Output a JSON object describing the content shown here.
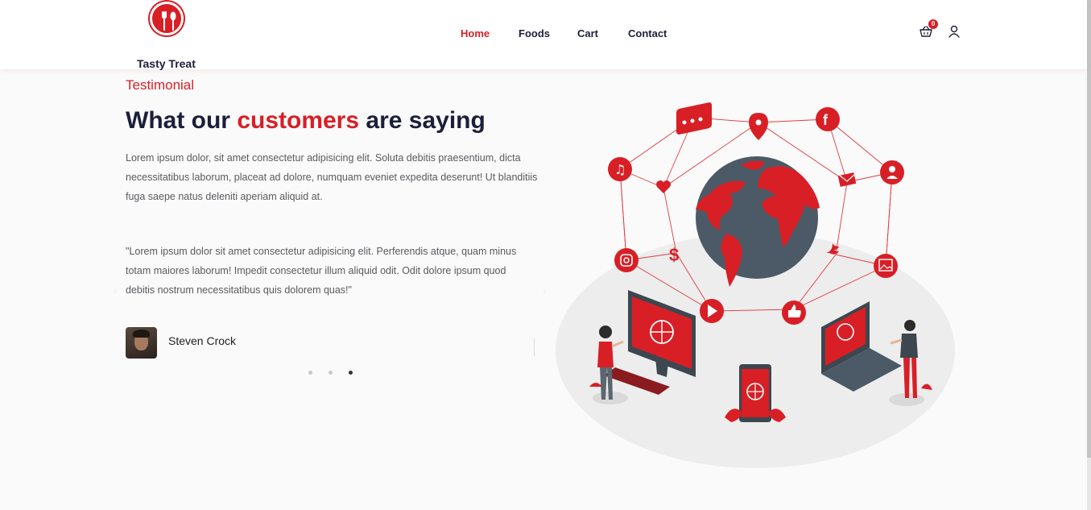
{
  "header": {
    "brand": "Tasty Treat",
    "nav": [
      {
        "label": "Home",
        "active": true
      },
      {
        "label": "Foods"
      },
      {
        "label": "Cart"
      },
      {
        "label": "Contact"
      }
    ],
    "cart_count": "0",
    "accent_color": "#d81f26",
    "icons": [
      "logo-utensils-icon",
      "basket-icon",
      "user-icon"
    ]
  },
  "testimonial": {
    "subtitle": "Testimonial",
    "heading_before": "What our ",
    "heading_accent": "customers",
    "heading_after": " are saying",
    "intro": "Lorem ipsum dolor, sit amet consectetur adipisicing elit. Soluta debitis praesentium, dicta necessitatibus laborum, placeat ad dolore, numquam eveniet expedita deserunt! Ut blanditiis fuga saepe natus deleniti aperiam aliquid at.",
    "quote": "\"Lorem ipsum dolor sit amet consectetur adipisicing elit. Perferendis atque, quam minus totam maiores laborum! Impedit consectetur illum aliquid odit. Odit dolore ipsum quod debitis nostrum necessitatibus quis dolorem quas!\"",
    "author": "Steven Crock",
    "slides": 3,
    "active_slide": 3
  },
  "illustration": {
    "name": "global-network-illustration",
    "icons": [
      "chat-icon",
      "location-pin-icon",
      "facebook-icon",
      "music-icon",
      "heart-icon",
      "mail-icon",
      "user-icon",
      "instagram-icon",
      "dollar-icon",
      "twitter-icon",
      "image-icon",
      "play-icon",
      "like-icon"
    ]
  }
}
